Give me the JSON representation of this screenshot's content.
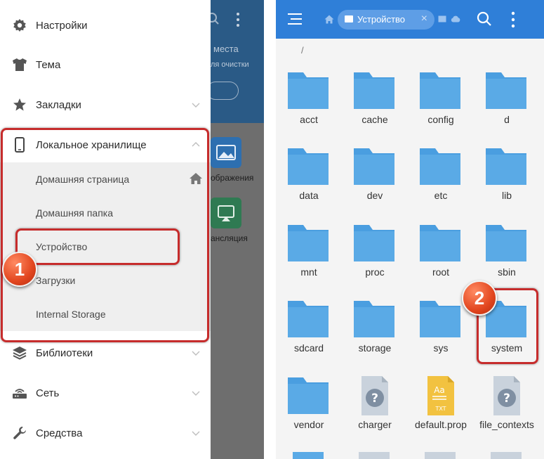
{
  "drawer": {
    "items": [
      {
        "label": "Настройки",
        "icon": "gear-icon"
      },
      {
        "label": "Тема",
        "icon": "shirt-icon"
      },
      {
        "label": "Закладки",
        "icon": "star-icon"
      },
      {
        "label": "Локальное хранилище",
        "icon": "phone-icon"
      },
      {
        "label": "Библиотеки",
        "icon": "layers-icon"
      },
      {
        "label": "Сеть",
        "icon": "network-icon"
      },
      {
        "label": "Средства",
        "icon": "wrench-icon"
      }
    ],
    "submenu": [
      "Домашняя страница",
      "Домашняя папка",
      "Устройство",
      "Загрузки",
      "Internal Storage"
    ]
  },
  "background": {
    "places_text": "места",
    "cleanup_text": "ля очистки",
    "images_label": "ображения",
    "cast_label": "ансляция"
  },
  "annotations": {
    "step1": "1",
    "step2": "2"
  },
  "explorer": {
    "breadcrumb": "Устройство",
    "path": "/",
    "files": [
      {
        "name": "acct",
        "type": "folder"
      },
      {
        "name": "cache",
        "type": "folder"
      },
      {
        "name": "config",
        "type": "folder"
      },
      {
        "name": "d",
        "type": "folder"
      },
      {
        "name": "data",
        "type": "folder"
      },
      {
        "name": "dev",
        "type": "folder"
      },
      {
        "name": "etc",
        "type": "folder"
      },
      {
        "name": "lib",
        "type": "folder"
      },
      {
        "name": "mnt",
        "type": "folder"
      },
      {
        "name": "proc",
        "type": "folder"
      },
      {
        "name": "root",
        "type": "folder"
      },
      {
        "name": "sbin",
        "type": "folder"
      },
      {
        "name": "sdcard",
        "type": "folder"
      },
      {
        "name": "storage",
        "type": "folder"
      },
      {
        "name": "sys",
        "type": "folder"
      },
      {
        "name": "system",
        "type": "folder"
      },
      {
        "name": "vendor",
        "type": "folder"
      },
      {
        "name": "charger",
        "type": "unknown"
      },
      {
        "name": "default.prop",
        "type": "text"
      },
      {
        "name": "file_contexts",
        "type": "unknown"
      }
    ]
  },
  "colors": {
    "accent": "#2f7fd8",
    "folder": "#5aaae6",
    "highlight": "#c62c2c",
    "badge": "#e2461f"
  }
}
